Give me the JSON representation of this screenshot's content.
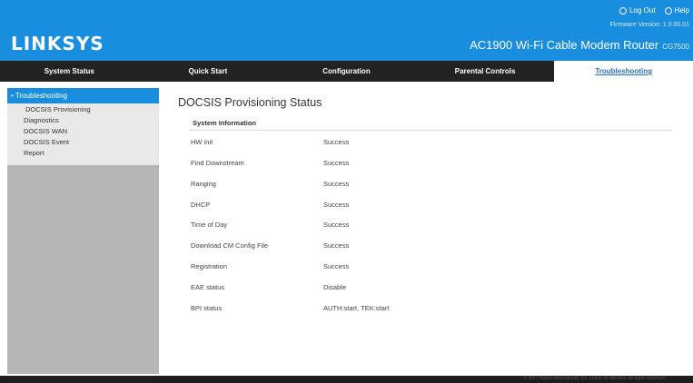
{
  "header": {
    "logo": "LINKSYS",
    "logout": "Log Out",
    "help": "Help",
    "firmware": "Firmware Version: 1.0.00.01",
    "product": "AC1900 Wi-Fi Cable Modem Router",
    "model": "CG7500",
    "brand_color": "#1a8ede"
  },
  "nav": {
    "items": [
      "System Status",
      "Quick Start",
      "Configuration",
      "Parental Controls",
      "Troubleshooting"
    ],
    "active": "Troubleshooting"
  },
  "sidebar": {
    "head": "Troubleshooting",
    "items": [
      "DOCSIS Provisioning",
      "Diagnostics",
      "DOCSIS WAN",
      "DOCSIS Event",
      "Report"
    ]
  },
  "main": {
    "title": "DOCSIS Provisioning Status",
    "section": "System Information",
    "rows": [
      {
        "label": "HW init",
        "value": "Success"
      },
      {
        "label": "Find Downstream",
        "value": "Success"
      },
      {
        "label": "Ranging",
        "value": "Success"
      },
      {
        "label": "DHCP",
        "value": "Success"
      },
      {
        "label": "Time of Day",
        "value": "Success"
      },
      {
        "label": "Download CM Config File",
        "value": "Success"
      },
      {
        "label": "Registration",
        "value": "Success"
      },
      {
        "label": "EAE status",
        "value": "Disable"
      },
      {
        "label": "BPI status",
        "value": "AUTH:start, TEK:start"
      }
    ]
  },
  "footer": {
    "text": "© 2017 Belkin International, Inc. and/or its affiliates. All rights reserved."
  }
}
